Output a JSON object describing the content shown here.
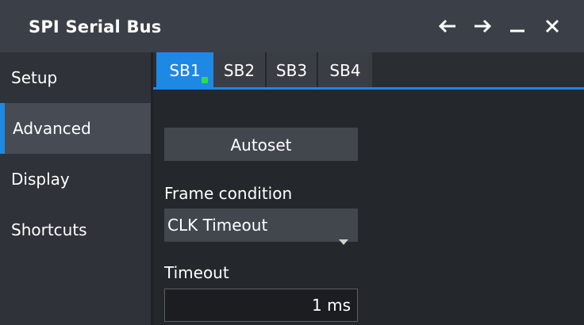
{
  "window": {
    "title": "SPI Serial Bus",
    "controls": [
      {
        "name": "back-arrow-icon"
      },
      {
        "name": "forward-arrow-icon"
      },
      {
        "name": "minimize-icon"
      },
      {
        "name": "close-icon"
      }
    ]
  },
  "sidebar": {
    "items": [
      {
        "label": "Setup",
        "active": false
      },
      {
        "label": "Advanced",
        "active": true
      },
      {
        "label": "Display",
        "active": false
      },
      {
        "label": "Shortcuts",
        "active": false
      }
    ]
  },
  "tabs": [
    {
      "label": "SB1",
      "active": true,
      "indicator_color": "#27e14a"
    },
    {
      "label": "SB2",
      "active": false
    },
    {
      "label": "SB3",
      "active": false
    },
    {
      "label": "SB4",
      "active": false
    }
  ],
  "main": {
    "autoset_label": "Autoset",
    "frame_condition": {
      "label": "Frame condition",
      "value": "CLK Timeout"
    },
    "timeout": {
      "label": "Timeout",
      "value": "1 ms"
    }
  },
  "colors": {
    "accent": "#1e88e5",
    "indicator": "#27e14a"
  }
}
